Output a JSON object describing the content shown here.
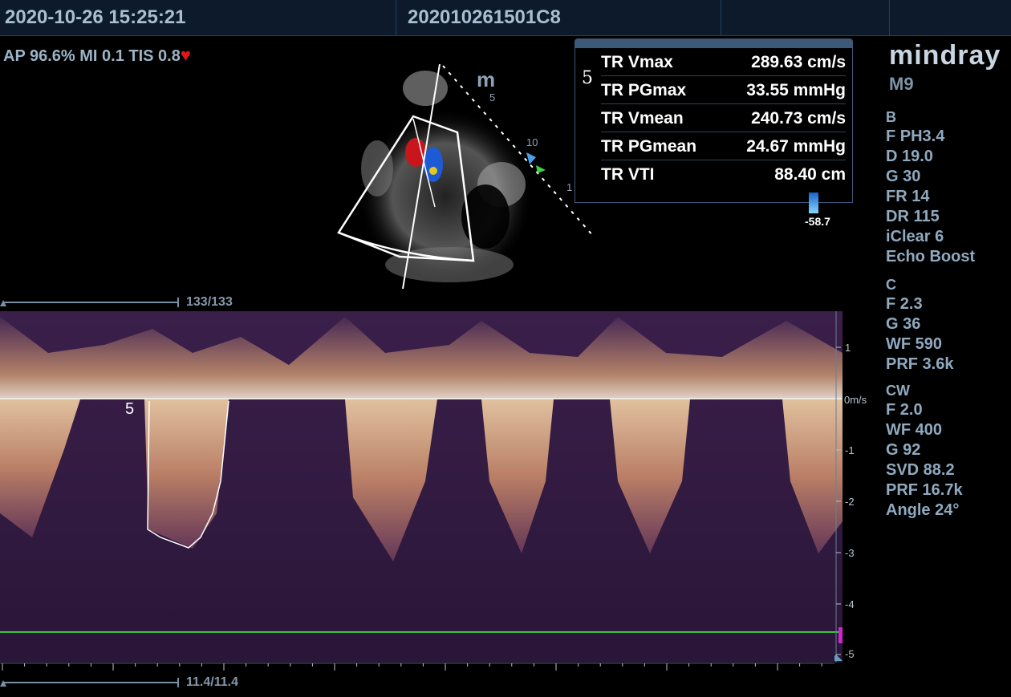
{
  "header": {
    "datetime": "2020-10-26 15:25:21",
    "patient_id": "202010261501C8"
  },
  "safety": {
    "ap": "AP 96.6%",
    "mi": "MI 0.1",
    "tis": "TIS 0.8",
    "heart_icon": "heart-icon",
    "heart_color": "#e0161c"
  },
  "brand": {
    "logo": "mindray",
    "model": "M9"
  },
  "measurement": {
    "index": "5",
    "rows": [
      {
        "name": "TR Vmax",
        "value": "289.63 cm/s"
      },
      {
        "name": "TR PGmax",
        "value": "33.55 mmHg"
      },
      {
        "name": "TR Vmean",
        "value": "240.73 cm/s"
      },
      {
        "name": "TR PGmean",
        "value": "24.67 mmHg"
      },
      {
        "name": "TR VTI",
        "value": "88.40 cm"
      }
    ]
  },
  "color_scale": {
    "value": "-58.7"
  },
  "probe_marks": {
    "logo": "m",
    "d5": "5",
    "d10": "10",
    "d1": "1"
  },
  "params": {
    "b": {
      "title": "B",
      "rows": [
        "F PH3.4",
        "D 19.0",
        "G 30",
        "FR 14",
        "DR 115",
        "iClear 6",
        "Echo Boost"
      ]
    },
    "c": {
      "title": "C",
      "rows": [
        "F 2.3",
        "G 36",
        "WF 590",
        "PRF 3.6k"
      ]
    },
    "cw": {
      "title": "CW",
      "rows": [
        "F 2.0",
        "WF 400",
        "G 92",
        "SVD 88.2",
        "PRF 16.7k",
        "Angle 24°"
      ]
    }
  },
  "scrollbars": {
    "top": "133/133",
    "bottom": "11.4/11.4"
  },
  "spectrum": {
    "unit": "0m/s",
    "axis_ticks": [
      "1",
      "-1",
      "-2",
      "-3",
      "-4",
      "-5"
    ],
    "marker_label": "5"
  }
}
